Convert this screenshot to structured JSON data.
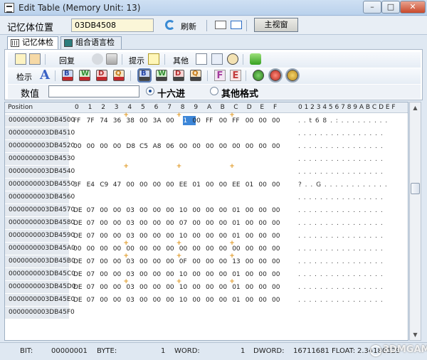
{
  "window": {
    "title": "Edit Table (Memory Unit: 13)",
    "minimize_label": "–",
    "maximize_label": "□",
    "close_label": "✕"
  },
  "address": {
    "label": "记忆体位置",
    "value": "03DB4508",
    "refresh_label": "刷新",
    "main_window_label": "主视窗"
  },
  "tabs": [
    {
      "label": "记忆体检示",
      "active": true
    },
    {
      "label": "组合语言检示",
      "active": false
    }
  ],
  "toolbar": {
    "restore_label": "回复",
    "hint_label": "提示",
    "other_label": "其他",
    "display_label": "检示",
    "chip_letters": [
      "B",
      "W",
      "D",
      "Q"
    ],
    "chip_dec": "DEC",
    "chip_hex": "HEX",
    "float_letters": [
      "F",
      "E"
    ]
  },
  "value_row": {
    "label": "数值",
    "input_value": "",
    "radio_hex_label": "十六进",
    "radio_other_label": "其他格式",
    "selected": "hex"
  },
  "grid": {
    "position_header": "Position",
    "hex_headers": [
      "0",
      "1",
      "2",
      "3",
      "4",
      "5",
      "6",
      "7",
      "8",
      "9",
      "A",
      "B",
      "C",
      "D",
      "E",
      "F"
    ],
    "ascii_header": "0 1 2 3 4 5 6 7 8 9 A B C D E F",
    "rows": [
      {
        "pos": "0000000003DB4500",
        "bytes": [
          "FF",
          "7F",
          "74",
          "36",
          "38",
          "00",
          "3A",
          "00",
          "01",
          "00",
          "FF",
          "00",
          "FF",
          "00",
          "00",
          "00"
        ],
        "ascii": ". . t 6 8 . : . . . . . . . . ."
      },
      {
        "pos": "0000000003DB4510",
        "bytes": [
          "",
          "",
          "",
          "",
          "",
          "",
          "",
          "",
          "",
          "",
          "",
          "",
          "",
          "",
          "",
          ""
        ],
        "ascii": ". . . . . . . . . . . . . . . ."
      },
      {
        "pos": "0000000003DB4520",
        "bytes": [
          "00",
          "00",
          "00",
          "00",
          "D8",
          "C5",
          "A8",
          "06",
          "00",
          "00",
          "00",
          "00",
          "00",
          "00",
          "00",
          "00"
        ],
        "ascii": ". . . . . . . . . . . . . . . ."
      },
      {
        "pos": "0000000003DB4530",
        "bytes": [
          "",
          "",
          "",
          "",
          "",
          "",
          "",
          "",
          "",
          "",
          "",
          "",
          "",
          "",
          "",
          ""
        ],
        "ascii": ". . . . . . . . . . . . . . . ."
      },
      {
        "pos": "0000000003DB4540",
        "bytes": [
          "",
          "",
          "",
          "",
          "",
          "",
          "",
          "",
          "",
          "",
          "",
          "",
          "",
          "",
          "",
          ""
        ],
        "ascii": ". . . . . . . . . . . . . . . ."
      },
      {
        "pos": "0000000003DB4550",
        "bytes": [
          "3F",
          "E4",
          "C9",
          "47",
          "00",
          "00",
          "00",
          "00",
          "EE",
          "01",
          "00",
          "00",
          "EE",
          "01",
          "00",
          "00"
        ],
        "ascii": "? . . G . . . . . . . . . . . ."
      },
      {
        "pos": "0000000003DB4560",
        "bytes": [
          "",
          "",
          "",
          "",
          "",
          "",
          "",
          "",
          "",
          "",
          "",
          "",
          "",
          "",
          "",
          ""
        ],
        "ascii": ". . . . . . . . . . . . . . . ."
      },
      {
        "pos": "0000000003DB4570",
        "bytes": [
          "DE",
          "07",
          "00",
          "00",
          "03",
          "00",
          "00",
          "00",
          "10",
          "00",
          "00",
          "00",
          "01",
          "00",
          "00",
          "00"
        ],
        "ascii": ". . . . . . . . . . . . . . . ."
      },
      {
        "pos": "0000000003DB4580",
        "bytes": [
          "DE",
          "07",
          "00",
          "00",
          "03",
          "00",
          "00",
          "00",
          "07",
          "00",
          "00",
          "00",
          "01",
          "00",
          "00",
          "00"
        ],
        "ascii": ". . . . . . . . . . . . . . . ."
      },
      {
        "pos": "0000000003DB4590",
        "bytes": [
          "DE",
          "07",
          "00",
          "00",
          "03",
          "00",
          "00",
          "00",
          "10",
          "00",
          "00",
          "00",
          "01",
          "00",
          "00",
          "00"
        ],
        "ascii": ". . . . . . . . . . . . . . . ."
      },
      {
        "pos": "0000000003DB45A0",
        "bytes": [
          "00",
          "00",
          "00",
          "00",
          "00",
          "00",
          "00",
          "00",
          "00",
          "00",
          "00",
          "00",
          "00",
          "00",
          "00",
          "00"
        ],
        "ascii": ". . . . . . . . . . . . . . . ."
      },
      {
        "pos": "0000000003DB45B0",
        "bytes": [
          "DE",
          "07",
          "00",
          "00",
          "03",
          "00",
          "00",
          "00",
          "0F",
          "00",
          "00",
          "00",
          "13",
          "00",
          "00",
          "00"
        ],
        "ascii": ". . . . . . . . . . . . . . . ."
      },
      {
        "pos": "0000000003DB45C0",
        "bytes": [
          "DE",
          "07",
          "00",
          "00",
          "03",
          "00",
          "00",
          "00",
          "10",
          "00",
          "00",
          "00",
          "01",
          "00",
          "00",
          "00"
        ],
        "ascii": ". . . . . . . . . . . . . . . ."
      },
      {
        "pos": "0000000003DB45D0",
        "bytes": [
          "DE",
          "07",
          "00",
          "00",
          "03",
          "00",
          "00",
          "00",
          "10",
          "00",
          "00",
          "00",
          "01",
          "00",
          "00",
          "00"
        ],
        "ascii": ". . . . . . . . . . . . . . . ."
      },
      {
        "pos": "0000000003DB45E0",
        "bytes": [
          "DE",
          "07",
          "00",
          "00",
          "03",
          "00",
          "00",
          "00",
          "10",
          "00",
          "00",
          "00",
          "01",
          "00",
          "00",
          "00"
        ],
        "ascii": ". . . . . . . . . . . . . . . ."
      },
      {
        "pos": "0000000003DB45F0",
        "bytes": [
          "",
          "",
          "",
          "",
          "",
          "",
          "",
          "",
          "",
          "",
          "",
          "",
          "",
          "",
          "",
          ""
        ],
        "ascii": ""
      }
    ]
  },
  "status": {
    "bit_label": "BIT:",
    "bit_value": "00000001",
    "byte_label": "BYTE:",
    "byte_value": "1",
    "word_label": "WORD:",
    "word_value": "1",
    "dword_label": "DWORD:",
    "dword_value": "16711681",
    "float_label": "FLOAT:",
    "float_value": "2.34180529"
  },
  "watermark": "3DMGAME",
  "colors": {
    "selection": "#3d86d8",
    "marker": "#e09a25",
    "address_input_bg": "#fbf6d8"
  }
}
